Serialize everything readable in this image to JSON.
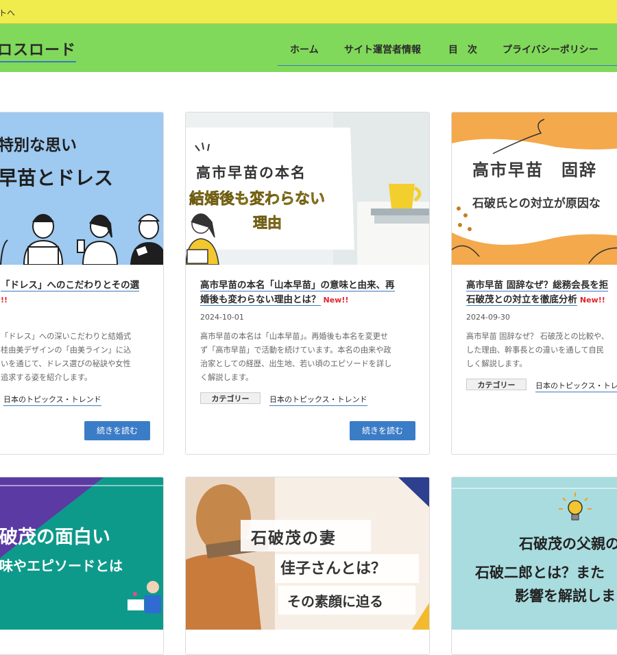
{
  "topbar": {
    "text": "トへ"
  },
  "header": {
    "logo": "ロスロード",
    "nav": [
      "ホーム",
      "サイト運営者情報",
      "目　次",
      "プライバシーポリシー"
    ]
  },
  "cards": [
    {
      "thumb_lines": [
        "特別な思い",
        "早苗とドレス"
      ],
      "title_lines": [
        "「ドレス」へのこだわりとその選",
        "!!"
      ],
      "date": "",
      "excerpt": [
        "「ドレス」への深いこだわりと結婚式",
        "桂由美デザインの「由美ライン」に込",
        "いを通じて、ドレス選びの秘訣や女性",
        "追求する姿を紹介します。"
      ],
      "category_label": "",
      "category_link": "日本のトピックス・トレンド",
      "button": "続きを読む"
    },
    {
      "thumb_lines": [
        "高市早苗の本名",
        "結婚後も変わらない",
        "理由"
      ],
      "title_lines": [
        "高市早苗の本名「山本早苗」の意味と由来、再",
        "婚後も変わらない理由とは？"
      ],
      "new_badge": "New!!",
      "date": "2024-10-01",
      "excerpt": [
        "高市早苗の本名は「山本早苗」。再婚後も本名を変更せ",
        "ず「高市早苗」で活動を続けています。本名の由来や政",
        "治家としての経歴、出生地、若い頃のエピソードを詳し",
        "く解説します。"
      ],
      "category_label": "カテゴリー",
      "category_link": "日本のトピックス・トレンド",
      "button": "続きを読む"
    },
    {
      "thumb_lines": [
        "高市早苗　固辞",
        "石破氏との対立が原因な"
      ],
      "title_lines": [
        "高市早苗 固辞なぜ？総務会長を拒",
        "石破茂との対立を徹底分析"
      ],
      "new_badge": "New!!",
      "date": "2024-09-30",
      "excerpt": [
        "高市早苗 固辞なぜ？ 石破茂との比較や、",
        "した理由、幹事長との違いを通して自民",
        "しく解説します。"
      ],
      "category_label": "カテゴリー",
      "category_link": "日本のトピックス・トレン",
      "button": ""
    },
    {
      "thumb_lines": [
        "破茂の面白い",
        "味やエピソードとは"
      ]
    },
    {
      "thumb_lines": [
        "石破茂の妻",
        "佳子さんとは？",
        "その素顔に迫る"
      ]
    },
    {
      "thumb_lines": [
        "石破茂の父親の",
        "石破二郎とは？また",
        "影響を解説しま"
      ]
    }
  ],
  "colors": {
    "topbar": "#f0ec4e",
    "header": "#80d95a",
    "accent_underline": "#3a78c4",
    "button": "#3b7cc7",
    "new_badge": "#e0262b"
  }
}
